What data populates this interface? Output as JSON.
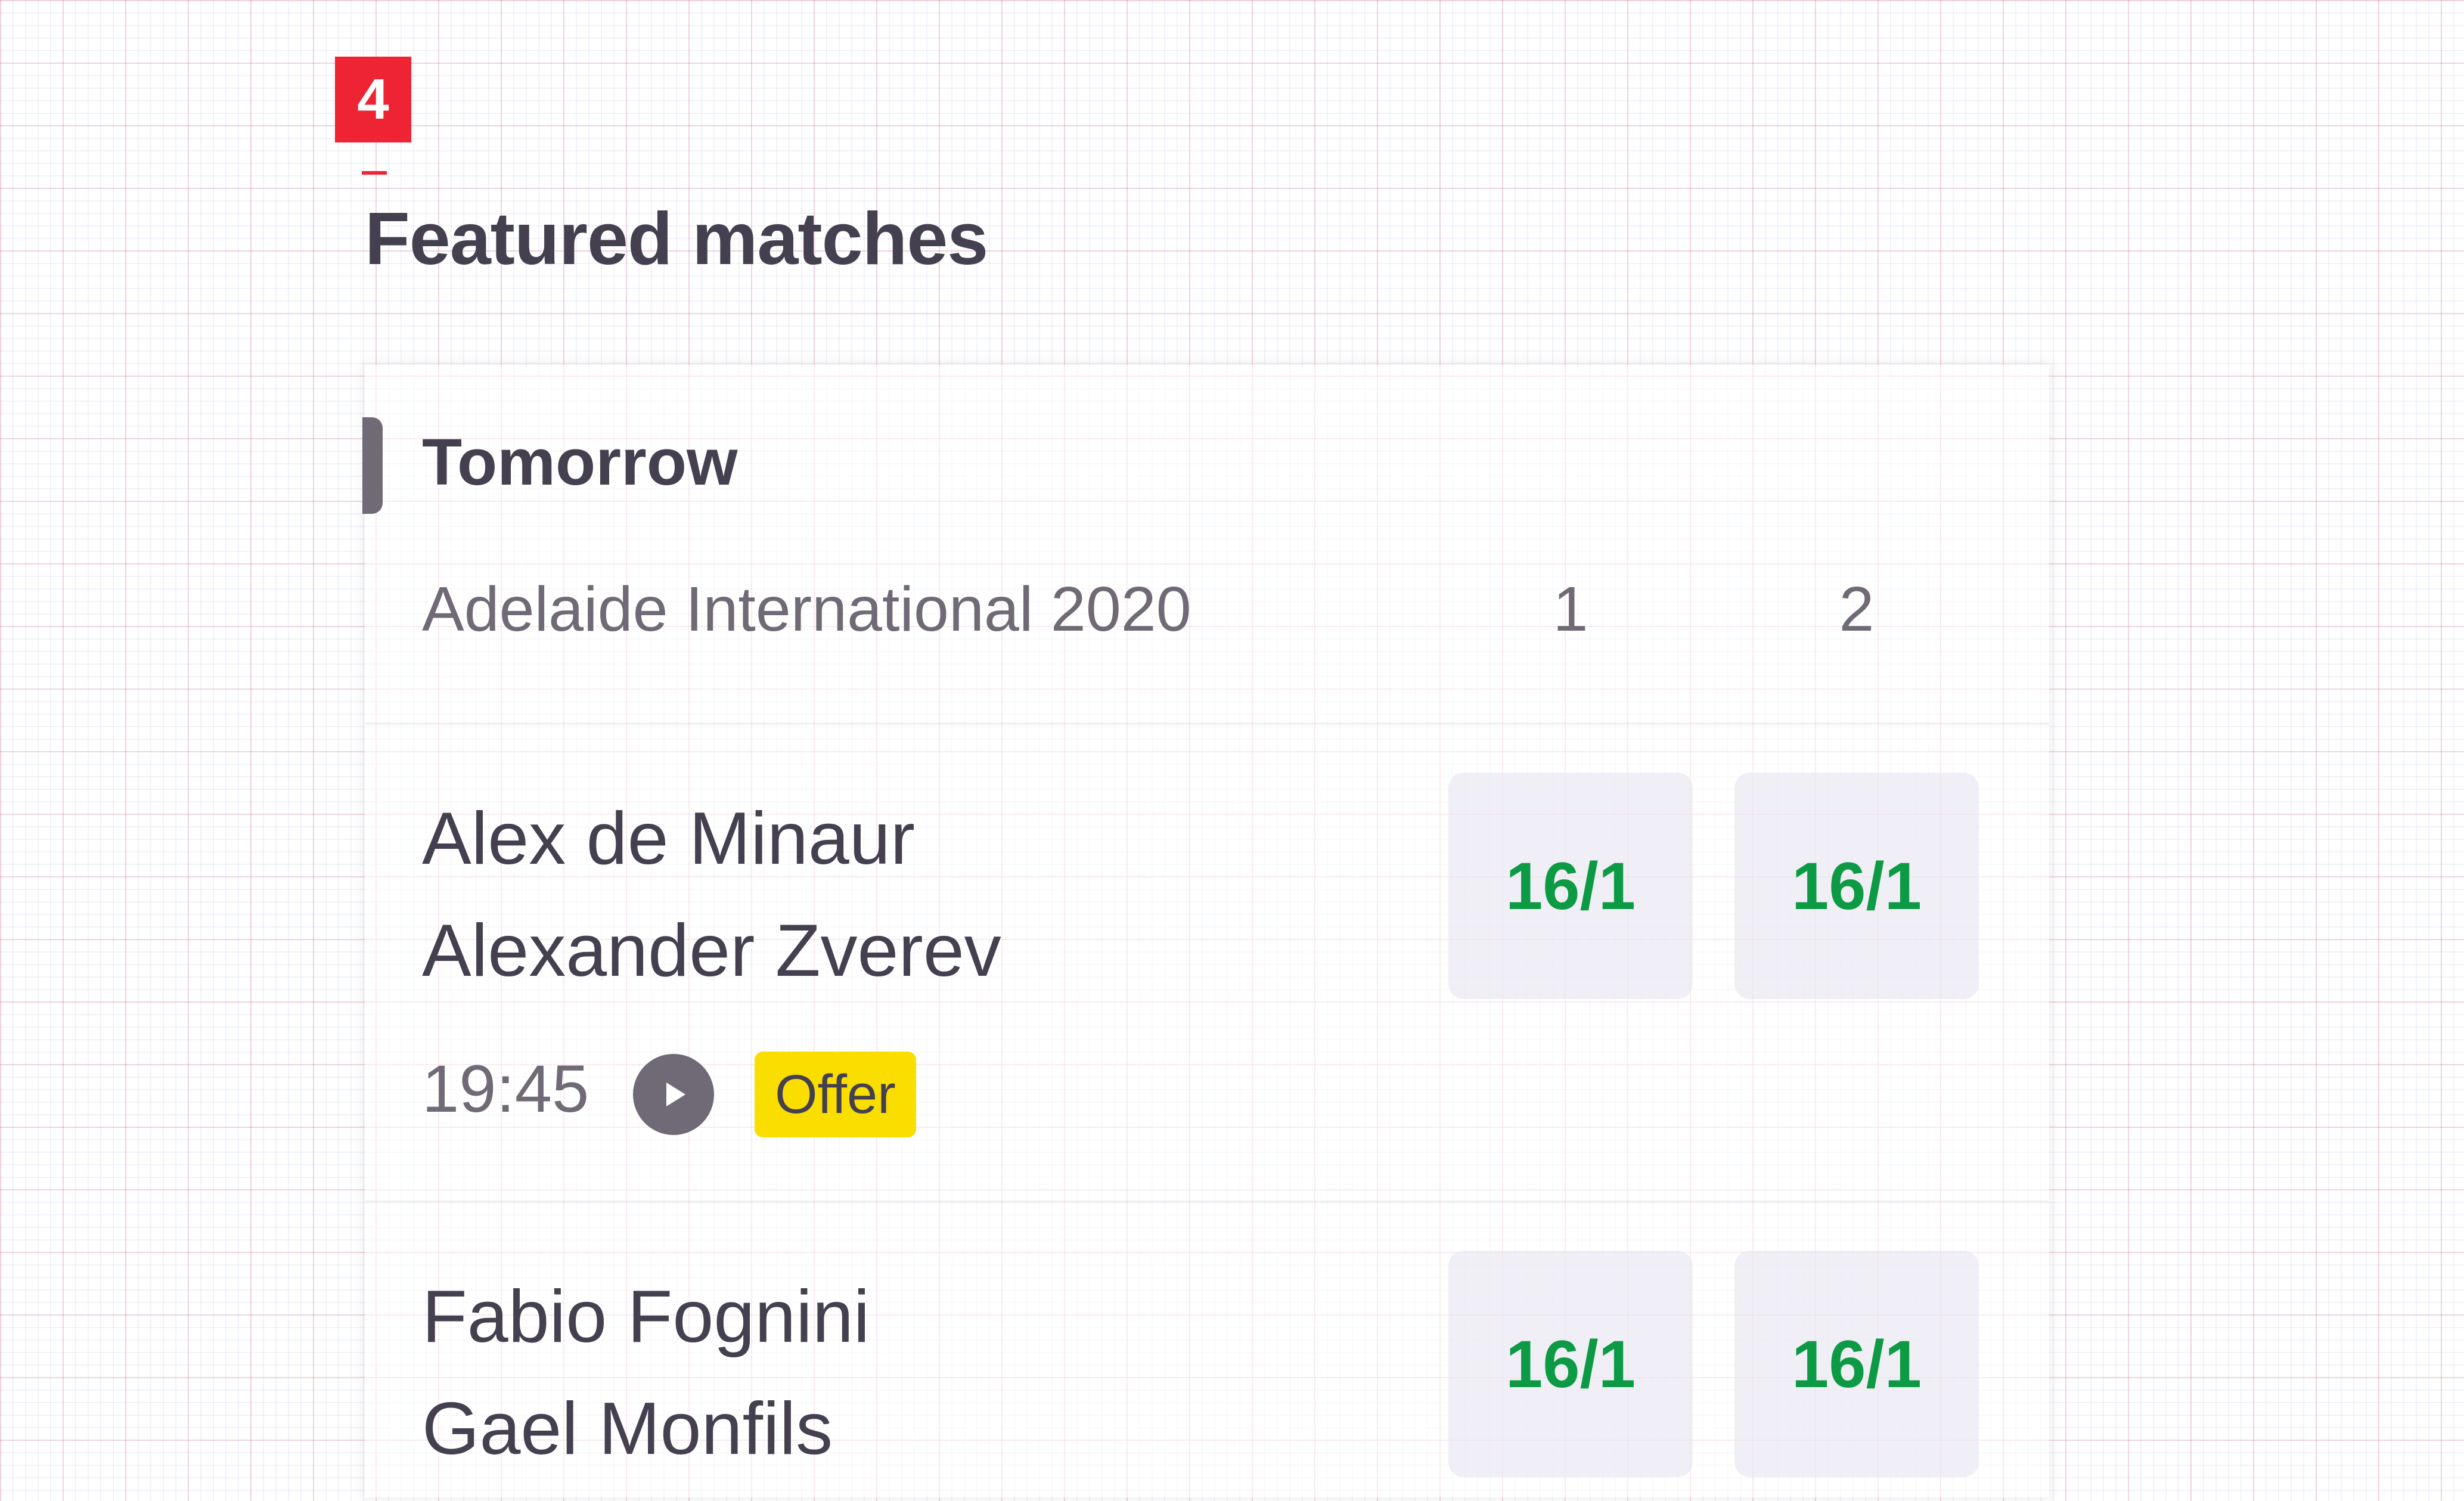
{
  "step": {
    "number": "4"
  },
  "section": {
    "title": "Featured matches"
  },
  "day": {
    "label": "Tomorrow"
  },
  "competition": {
    "name": "Adelaide International 2020",
    "col1": "1",
    "col2": "2"
  },
  "matches": [
    {
      "player1": "Alex de Minaur",
      "player2": "Alexander Zverev",
      "odds1": "16/1",
      "odds2": "16/1",
      "time": "19:45",
      "offer": "Offer"
    },
    {
      "player1": "Fabio Fognini",
      "player2": "Gael Monfils",
      "odds1": "16/1",
      "odds2": "16/1"
    }
  ],
  "colors": {
    "accent_red": "#ee2435",
    "text_dark": "#45404f",
    "text_muted": "#6f6a75",
    "odds_green": "#0d9a45",
    "offer_yellow": "#f9de00",
    "odds_bg": "#e8e4f0"
  },
  "icons": {
    "live_stream": "play-circle-icon"
  }
}
